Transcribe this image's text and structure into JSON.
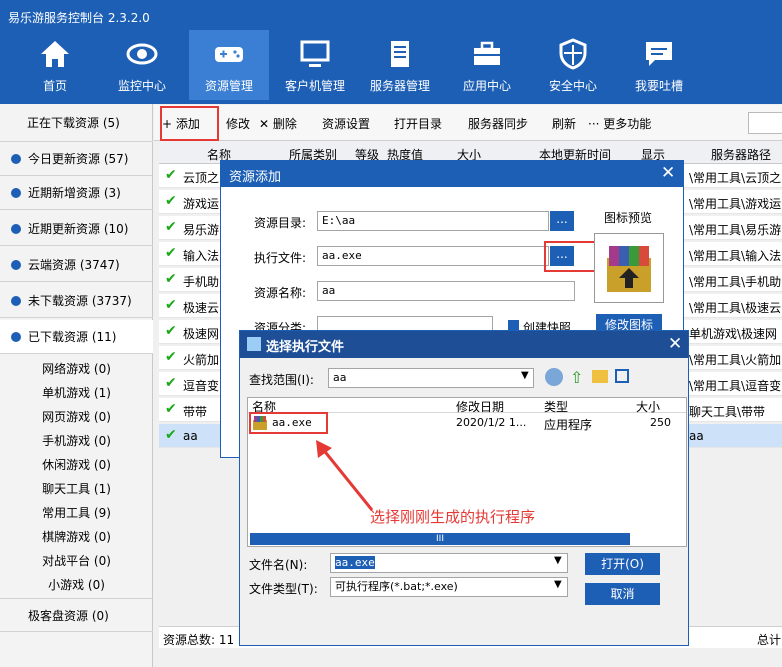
{
  "app": {
    "title": "易乐游服务控制台 2.3.2.0"
  },
  "nav": [
    {
      "label": "首页",
      "icon": "home-icon"
    },
    {
      "label": "监控中心",
      "icon": "eye-icon"
    },
    {
      "label": "资源管理",
      "icon": "gamepad-icon",
      "active": true
    },
    {
      "label": "客户机管理",
      "icon": "monitor-icon"
    },
    {
      "label": "服务器管理",
      "icon": "server-icon"
    },
    {
      "label": "应用中心",
      "icon": "toolbox-icon"
    },
    {
      "label": "安全中心",
      "icon": "shield-icon"
    },
    {
      "label": "我要吐槽",
      "icon": "chat-icon"
    }
  ],
  "sidebar": {
    "items": [
      {
        "label": "正在下载资源 (5)"
      },
      {
        "label": "今日更新资源 (57)"
      },
      {
        "label": "近期新增资源 (3)"
      },
      {
        "label": "近期更新资源 (10)"
      },
      {
        "label": "云端资源 (3747)"
      },
      {
        "label": "未下载资源 (3737)"
      },
      {
        "label": "已下载资源 (11)"
      }
    ],
    "sub": [
      "网络游戏 (0)",
      "单机游戏 (1)",
      "网页游戏 (0)",
      "手机游戏 (0)",
      "休闲游戏 (0)",
      "聊天工具 (1)",
      "常用工具 (9)",
      "棋牌游戏 (0)",
      "对战平台 (0)",
      "小游戏 (0)"
    ],
    "bottom": "极客盘资源 (0)"
  },
  "toolbar": {
    "add": "+ 添加",
    "modify": "修改",
    "delete": "✕ 删除",
    "settings": "资源设置",
    "open_dir": "打开目录",
    "sync": "服务器同步",
    "refresh": "刷新",
    "more": "··· 更多功能"
  },
  "grid": {
    "headers": [
      "名称",
      "所属类别",
      "等级",
      "热度值",
      "大小",
      "本地更新时间",
      "显示",
      "服务器路径"
    ],
    "rows": [
      {
        "name": "云顶之",
        "path": "\\常用工具\\云顶之"
      },
      {
        "name": "游戏运",
        "path": "\\常用工具\\游戏运"
      },
      {
        "name": "易乐游",
        "path": "\\常用工具\\易乐游"
      },
      {
        "name": "输入法",
        "path": "\\常用工具\\输入法"
      },
      {
        "name": "手机助",
        "path": "\\常用工具\\手机助"
      },
      {
        "name": "极速云",
        "path": "\\常用工具\\极速云"
      },
      {
        "name": "极速网",
        "path": "单机游戏\\极速网"
      },
      {
        "name": "火箭加",
        "path": "\\常用工具\\火箭加"
      },
      {
        "name": "逗音变",
        "path": "\\常用工具\\逗音变"
      },
      {
        "name": "带带",
        "path": "聊天工具\\带带"
      },
      {
        "name": "aa",
        "path": "aa"
      }
    ]
  },
  "status": {
    "total": "资源总数: 11",
    "right": "总计"
  },
  "dialog_add": {
    "title": "资源添加",
    "dir_label": "资源目录:",
    "dir_value": "E:\\aa",
    "exe_label": "执行文件:",
    "exe_value": "aa.exe",
    "name_label": "资源名称:",
    "name_value": "aa",
    "cat_label": "资源分类:",
    "shortcut": "创建快照",
    "preview": "图标预览",
    "change_icon": "修改图标",
    "browse": "..."
  },
  "dialog_open": {
    "title": "选择执行文件",
    "look_label": "查找范围(I):",
    "look_value": "aa",
    "cols": [
      "名称",
      "修改日期",
      "类型",
      "大小"
    ],
    "file": {
      "name": "aa.exe",
      "date": "2020/1/2 1...",
      "type": "应用程序",
      "size": "250"
    },
    "annotation": "选择刚刚生成的执行程序",
    "fname_label": "文件名(N):",
    "fname_value": "aa.exe",
    "ftype_label": "文件类型(T):",
    "ftype_value": "可执行程序(*.bat;*.exe)",
    "open": "打开(O)",
    "cancel": "取消",
    "scroll": "III"
  }
}
